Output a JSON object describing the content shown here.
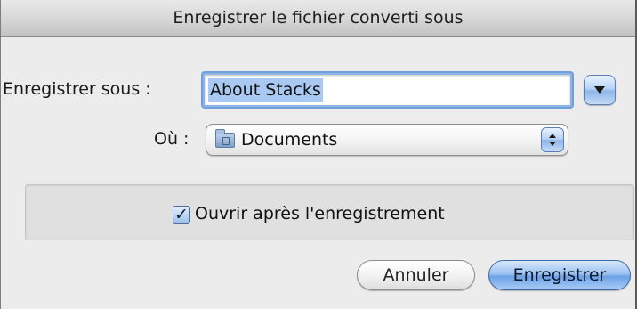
{
  "window": {
    "title": "Enregistrer le fichier converti sous"
  },
  "save_as": {
    "label": "Enregistrer sous :",
    "value": "About Stacks"
  },
  "location": {
    "label": "Où :",
    "selected": "Documents"
  },
  "options": {
    "open_after_save_label": "Ouvrir après l'enregistrement",
    "open_after_save_checked": true,
    "check_glyph": "✓"
  },
  "buttons": {
    "cancel": "Annuler",
    "save": "Enregistrer"
  },
  "icons": {
    "expand": "disclosure-down-icon",
    "folder": "folder-icon",
    "popup_arrows": "updown-arrows-icon"
  },
  "colors": {
    "accent": "#6da1e6",
    "selection": "#a9c9f3"
  }
}
